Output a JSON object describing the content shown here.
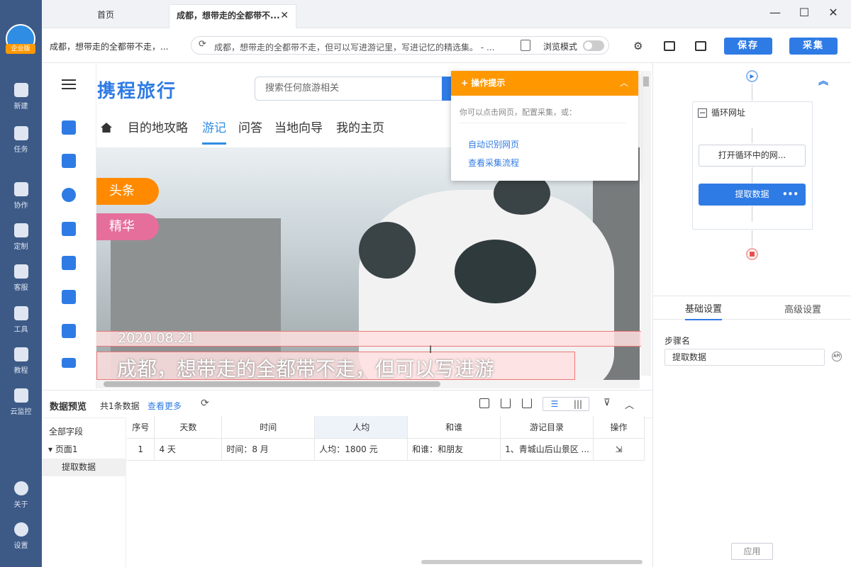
{
  "app": {
    "logo_badge": "企业版",
    "sidebar": [
      {
        "label": "新建",
        "icon": "plus-icon"
      },
      {
        "label": "任务",
        "icon": "task-icon"
      },
      {
        "label": "协作",
        "icon": "users-icon"
      },
      {
        "label": "定制",
        "icon": "heart-icon"
      },
      {
        "label": "客服",
        "icon": "headset-icon"
      },
      {
        "label": "工具",
        "icon": "toolbox-icon"
      },
      {
        "label": "教程",
        "icon": "graduation-cap-icon"
      },
      {
        "label": "云监控",
        "icon": "monitor-icon"
      },
      {
        "label": "关于",
        "icon": "info-icon"
      },
      {
        "label": "设置",
        "icon": "gear-icon"
      }
    ]
  },
  "tabs": {
    "home": "首页",
    "active": "成都，想带走的全都带不...",
    "close": "✕"
  },
  "window": {
    "minimize": "—",
    "maximize": "☐",
    "close": "✕"
  },
  "toolbar": {
    "page_title": "成都，想带走的全都带不走，...",
    "url": "成都，想带走的全都带不走，但可以写进游记里，写进记忆的精选集。 - ...",
    "browse_mode": "浏览模式",
    "save": "保存",
    "collect": "采集"
  },
  "site": {
    "logo": "携程旅行",
    "search_placeholder": "搜索任何旅游相关",
    "nav": [
      "目的地攻略",
      "游记",
      "问答",
      "当地向导",
      "我的主页"
    ],
    "active_nav": "游记",
    "badge_hot": "头条",
    "badge_best": "精华",
    "date": "2020.08.21",
    "title": "成都，想带走的全都带不走，但可以写进游"
  },
  "hint": {
    "title": "操作提示",
    "desc": "你可以点击网页，配置采集，或：",
    "links": [
      "自动识别网页",
      "查看采集流程"
    ]
  },
  "preview": {
    "title": "数据预览",
    "count": "共1条数据",
    "more": "查看更多",
    "fields_all": "全部字段",
    "page": "页面1",
    "item": "提取数据",
    "columns": [
      "序号",
      "天数",
      "时间",
      "人均",
      "和谁",
      "游记目录",
      "操作"
    ],
    "rows": [
      [
        "1",
        "4 天",
        "时间：8 月",
        "人均：1800 元",
        "和谁：和朋友",
        "1、青城山后山景区 ...",
        "⇲"
      ]
    ]
  },
  "flow": {
    "loop": "循环网址",
    "open": "打开循环中的网...",
    "extract": "提取数据",
    "more": "•••"
  },
  "props": {
    "tab_basic": "基础设置",
    "tab_adv": "高级设置",
    "step_label": "步骤名",
    "step_value": "提取数据",
    "apply": "应用"
  },
  "colors": {
    "primary": "#2f7be5",
    "sidebar_bg": "#3d5a87",
    "hint_orange": "#ff9800",
    "badge_hot": "#ff8a00",
    "badge_best": "#e56f9a"
  }
}
